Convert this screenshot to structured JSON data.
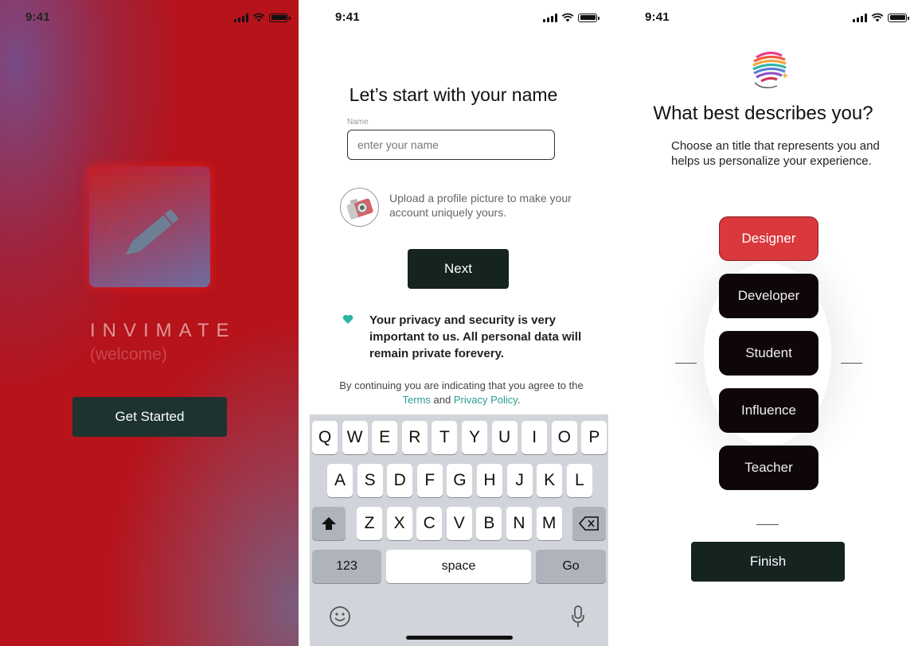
{
  "status_bar": {
    "time": "9:41"
  },
  "welcome_screen": {
    "brand": "INVIMATE",
    "tagline": "(welcome)",
    "get_started_label": "Get Started"
  },
  "name_screen": {
    "title": "Let’s start with your name",
    "name_field": {
      "label": "Name",
      "placeholder": "enter your name",
      "value": ""
    },
    "upload_text": "Upload a profile picture to make your account uniquely yours.",
    "next_label": "Next",
    "privacy_text": "Your privacy and security is very important to us. All personal data will remain private forevery.",
    "legal": {
      "prefix": "By continuing you are indicating that you agree to the",
      "terms": "Terms",
      "and": "and",
      "privacy_policy": "Privacy Policy",
      "suffix": "."
    },
    "keyboard": {
      "row1": [
        "Q",
        "W",
        "E",
        "R",
        "T",
        "Y",
        "U",
        "I",
        "O",
        "P"
      ],
      "row2": [
        "A",
        "S",
        "D",
        "F",
        "G",
        "H",
        "J",
        "K",
        "L"
      ],
      "row3": [
        "Z",
        "X",
        "C",
        "V",
        "B",
        "N",
        "M"
      ],
      "numbers_label": "123",
      "space_label": "space",
      "go_label": "Go"
    },
    "accent_color": "#2a9d8f"
  },
  "role_screen": {
    "title": "What best describes you?",
    "description": "Choose an title that represents you and helps us personalize your experience.",
    "roles": [
      "Designer",
      "Developer",
      "Student",
      "Influence",
      "Teacher"
    ],
    "selected_role": "Designer",
    "finish_label": "Finish",
    "selected_color": "#d9383d"
  }
}
